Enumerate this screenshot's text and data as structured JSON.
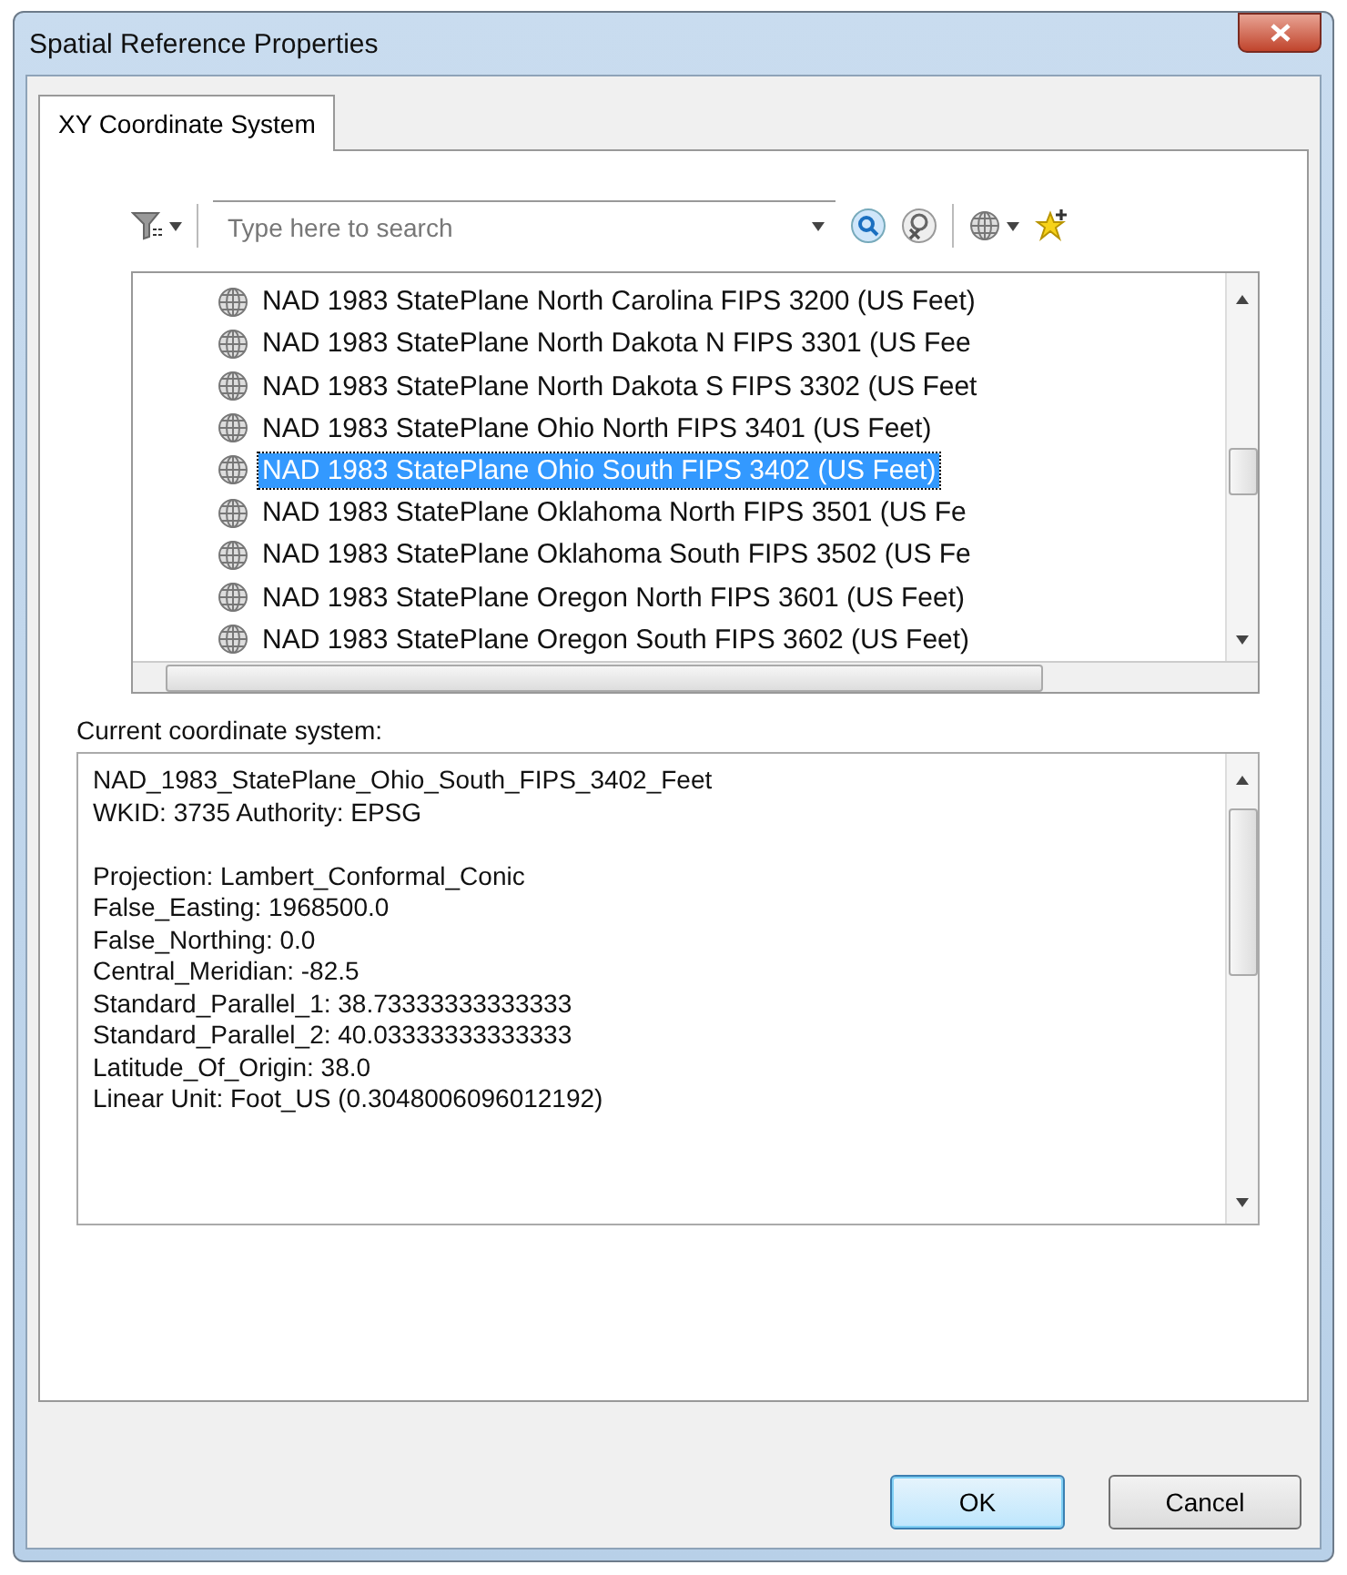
{
  "window": {
    "title": "Spatial Reference Properties"
  },
  "tabs": [
    {
      "label": "XY Coordinate System",
      "selected": true
    }
  ],
  "search": {
    "placeholder": "Type here to search"
  },
  "list": {
    "items": [
      {
        "label": "NAD 1983 StatePlane North Carolina FIPS 3200 (US Feet)",
        "selected": false
      },
      {
        "label": "NAD 1983 StatePlane North Dakota N FIPS 3301 (US Fee",
        "selected": false
      },
      {
        "label": "NAD 1983 StatePlane North Dakota S FIPS 3302 (US Feet",
        "selected": false
      },
      {
        "label": "NAD 1983 StatePlane Ohio North FIPS 3401 (US Feet)",
        "selected": false
      },
      {
        "label": "NAD 1983 StatePlane Ohio South FIPS 3402 (US Feet)",
        "selected": true
      },
      {
        "label": "NAD 1983 StatePlane Oklahoma North FIPS 3501 (US Fe",
        "selected": false
      },
      {
        "label": "NAD 1983 StatePlane Oklahoma South FIPS 3502 (US Fe",
        "selected": false
      },
      {
        "label": "NAD 1983 StatePlane Oregon North FIPS 3601 (US Feet)",
        "selected": false
      },
      {
        "label": "NAD 1983 StatePlane Oregon South FIPS 3602 (US Feet)",
        "selected": false
      }
    ]
  },
  "current": {
    "label": "Current coordinate system:",
    "header_lines": [
      "NAD_1983_StatePlane_Ohio_South_FIPS_3402_Feet",
      "WKID: 3735 Authority: EPSG"
    ],
    "lines": [
      "Projection: Lambert_Conformal_Conic",
      "False_Easting: 1968500.0",
      "False_Northing: 0.0",
      "Central_Meridian: -82.5",
      "Standard_Parallel_1: 38.73333333333333",
      "Standard_Parallel_2: 40.03333333333333",
      "Latitude_Of_Origin: 38.0",
      "Linear Unit: Foot_US (0.3048006096012192)"
    ]
  },
  "buttons": [
    {
      "label": "OK",
      "default": true
    },
    {
      "label": "Cancel",
      "default": false
    }
  ]
}
